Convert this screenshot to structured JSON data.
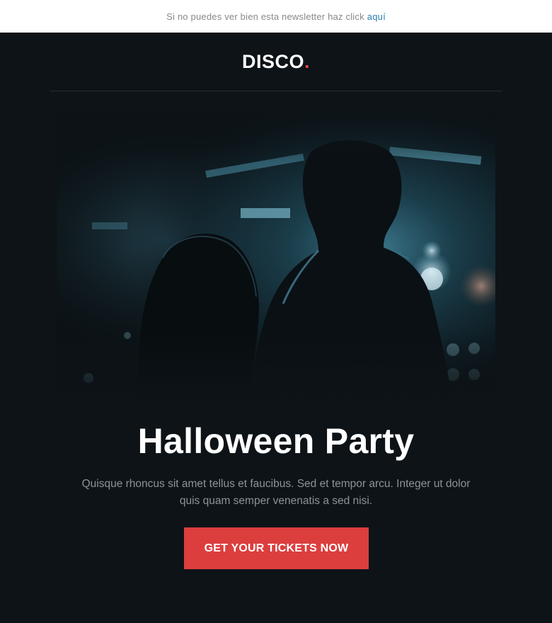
{
  "preheader": {
    "text": "Si no puedes ver bien esta newsletter haz click",
    "link_label": "aquí"
  },
  "header": {
    "logo_text": "DISCO",
    "logo_dot": "."
  },
  "hero": {
    "image_description_icon": "photo-couple-dark-club"
  },
  "content": {
    "headline": "Halloween Party",
    "body": "Quisque rhoncus sit amet tellus et faucibus. Sed et tempor arcu. Integer ut dolor quis quam semper venenatis a sed nisi.",
    "cta_label": "GET YOUR TICKETS NOW"
  },
  "colors": {
    "background": "#0d1317",
    "accent": "#dc3e3e",
    "link": "#2a7fb0"
  }
}
